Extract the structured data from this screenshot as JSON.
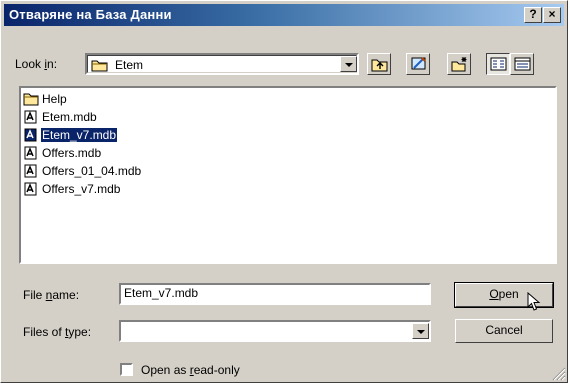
{
  "title": "Отваряне на База Данни",
  "title_buttons": {
    "help": "?",
    "close": "×"
  },
  "look_in": {
    "label_pre": "Look ",
    "label_u": "i",
    "label_post": "n:",
    "value": "Etem"
  },
  "toolbar_icons": [
    "up-one-level-icon",
    "desktop-icon",
    "new-folder-icon",
    "list-view-icon",
    "details-view-icon"
  ],
  "files": [
    {
      "name": "Help",
      "kind": "folder",
      "selected": false
    },
    {
      "name": "Etem.mdb",
      "kind": "mdb",
      "selected": false
    },
    {
      "name": "Etem_v7.mdb",
      "kind": "mdb",
      "selected": true
    },
    {
      "name": "Offers.mdb",
      "kind": "mdb",
      "selected": false
    },
    {
      "name": "Offers_01_04.mdb",
      "kind": "mdb",
      "selected": false
    },
    {
      "name": "Offers_v7.mdb",
      "kind": "mdb",
      "selected": false
    }
  ],
  "file_name": {
    "label_pre": "File ",
    "label_u": "n",
    "label_post": "ame:",
    "value": "Etem_v7.mdb"
  },
  "file_type": {
    "label_pre": "Files of ",
    "label_u": "t",
    "label_post": "ype:",
    "value": ""
  },
  "buttons": {
    "open_u": "O",
    "open_rest": "pen",
    "cancel": "Cancel"
  },
  "readonly": {
    "label_pre": "Open as ",
    "label_u": "r",
    "label_post": "ead-only",
    "checked": false
  },
  "colors": {
    "title_start": "#0a246a",
    "title_end": "#a6caf0",
    "face": "#d4d0c8",
    "selection": "#0a246a"
  }
}
